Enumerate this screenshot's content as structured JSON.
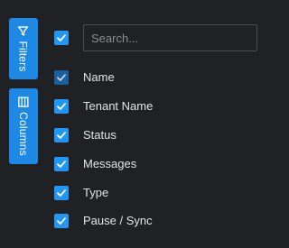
{
  "side_tabs": {
    "filters": {
      "label": "Filters",
      "icon": "filter-icon"
    },
    "columns": {
      "label": "Columns",
      "icon": "columns-icon"
    }
  },
  "search": {
    "placeholder": "Search...",
    "value": ""
  },
  "select_all": {
    "checked": true
  },
  "columns": [
    {
      "label": "Name",
      "checked": true
    },
    {
      "label": "Tenant Name",
      "checked": true
    },
    {
      "label": "Status",
      "checked": true
    },
    {
      "label": "Messages",
      "checked": true
    },
    {
      "label": "Type",
      "checked": true
    },
    {
      "label": "Pause / Sync",
      "checked": true
    }
  ],
  "colors": {
    "background": "#202124",
    "accent": "#1e88e5",
    "checkbox": "#2196f3",
    "checkbox_disabled": "#1d5f9c"
  }
}
